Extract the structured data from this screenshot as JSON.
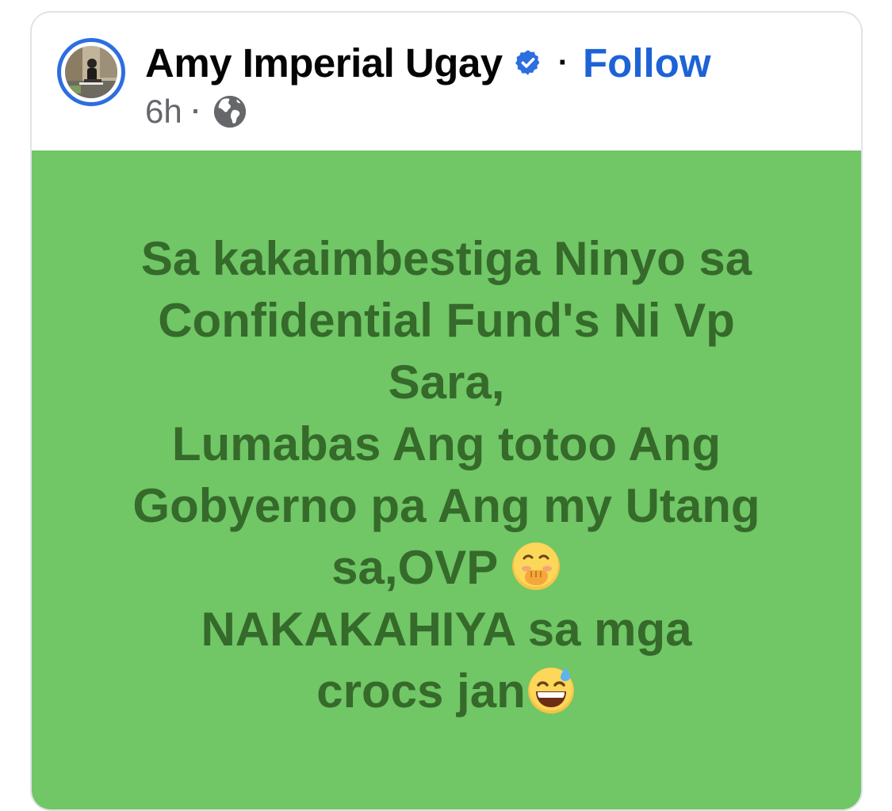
{
  "post": {
    "author": {
      "name": "Amy Imperial Ugay",
      "verified": true
    },
    "follow_label": "Follow",
    "separator": "·",
    "timestamp": "6h",
    "audience_icon": "globe-icon",
    "background_color": "#71c666",
    "text_color": "#356a2b",
    "lines": [
      "Sa kakaimbestiga Ninyo sa",
      "Confidential Fund's Ni Vp",
      "Sara,",
      "Lumabas Ang totoo Ang",
      "Gobyerno pa Ang my Utang",
      "sa,OVP ",
      "NAKAKAHIYA sa mga",
      "crocs jan"
    ],
    "emojis": {
      "line6": "face-with-hand-over-mouth-emoji",
      "line8": "grinning-sweat-emoji"
    }
  },
  "colors": {
    "link": "#1d63d6",
    "verified_badge": "#2d6ee0",
    "avatar_ring": "#2d6ee0",
    "meta_text": "#65676b"
  }
}
